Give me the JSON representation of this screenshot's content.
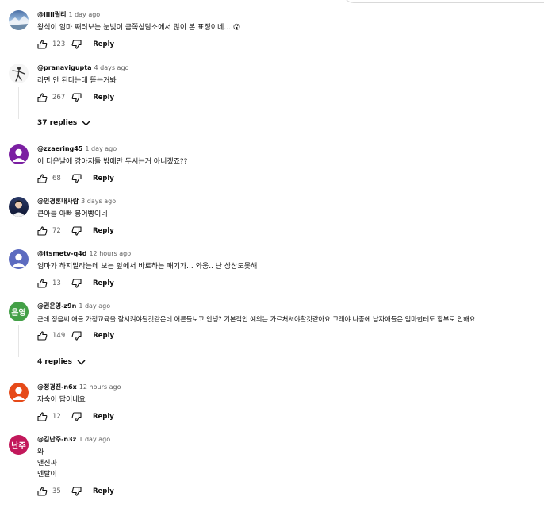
{
  "reply_label": "Reply",
  "comments": [
    {
      "author": "@lilli릴리",
      "time": "1 day ago",
      "text": "왕식이 엄마 째려보는 눈빛이 금쪽상담소에서 많이 본 표정이네... 😮",
      "likes": "123",
      "avatar_icon": "landscape-avatar"
    },
    {
      "author": "@pranavigupta",
      "time": "4 days ago",
      "text": "라면 안 된다는데 뜯는거봐",
      "likes": "267",
      "avatar_icon": "dancer-avatar",
      "replies": "37 replies"
    },
    {
      "author": "@zzaering45",
      "time": "1 day ago",
      "text": "이 더운날에 강아지들 밖에만 두시는거 아니겠죠??",
      "likes": "68",
      "avatar_icon": "person-avatar",
      "avatar_color": "#7b1fa2"
    },
    {
      "author": "@인경혼내사람",
      "time": "3 days ago",
      "text": "큰아들 아빠 붕어빵이네",
      "likes": "72",
      "avatar_icon": "photo-avatar"
    },
    {
      "author": "@itsmetv-q4d",
      "time": "12 hours ago",
      "text": "엄마가 하지말라는데 보는 앞에서 바로하는 패기가... 와웅.. 난 상상도못해",
      "likes": "13",
      "avatar_icon": "person-avatar",
      "avatar_color": "#5c6bc0"
    },
    {
      "author": "@권은영-z9n",
      "time": "1 day ago",
      "text": "근데 정음씨 애들 가정교육을 잘시켜야될것같은데 어른들보고 안녕? 기본적인 예의는 가르처셔야할것같아요 그래야 나중에 남자애들은 엄마한테도 함부로 안해요",
      "likes": "149",
      "avatar_label": "은영",
      "avatar_color": "#43a047",
      "replies": "4 replies"
    },
    {
      "author": "@정경진-n6x",
      "time": "12 hours ago",
      "text": "자숙이 답이네요",
      "likes": "12",
      "avatar_icon": "person-avatar",
      "avatar_color": "#e64a19"
    },
    {
      "author": "@김난주-n3z",
      "time": "1 day ago",
      "text_lines": [
        "와",
        "앤진짜",
        "멘탈이"
      ],
      "likes": "35",
      "avatar_label": "난주",
      "avatar_color": "#c2185b"
    }
  ]
}
